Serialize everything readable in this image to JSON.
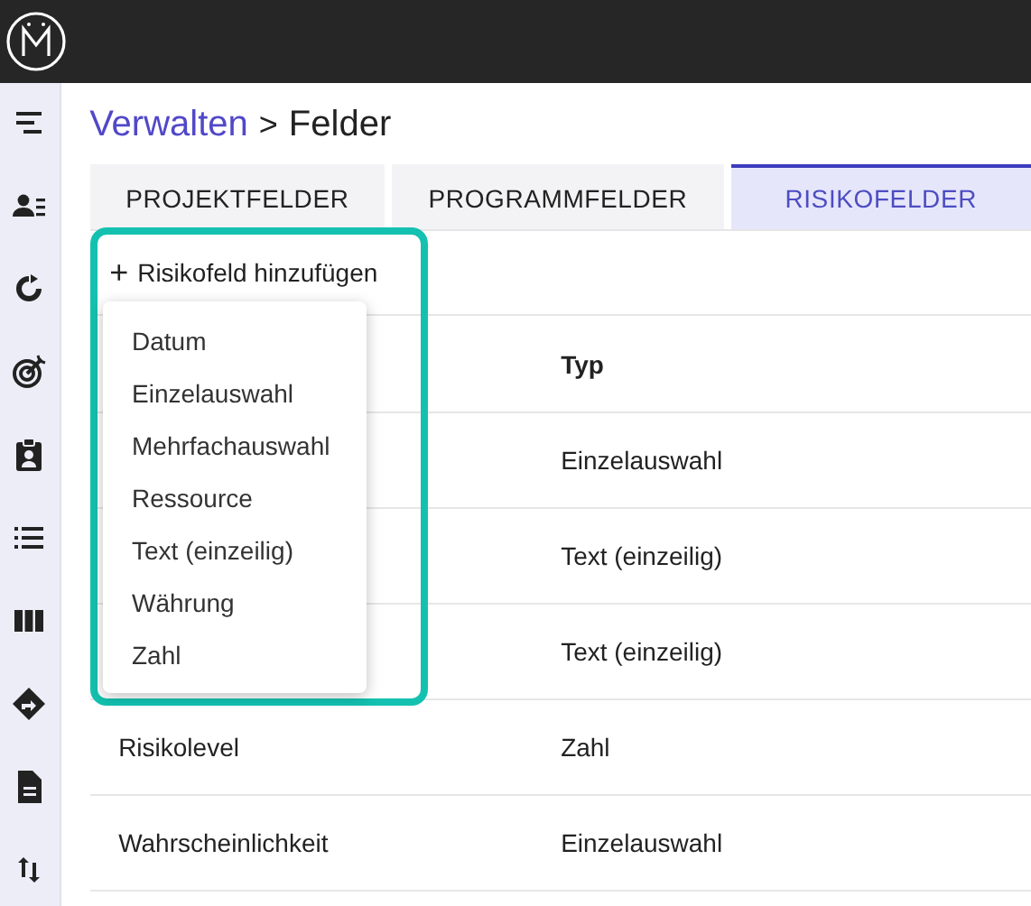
{
  "breadcrumb": {
    "parent": "Verwalten",
    "separator": ">",
    "current": "Felder"
  },
  "tabs": [
    {
      "label": "PROJEKTFELDER",
      "selected": false
    },
    {
      "label": "PROGRAMMFELDER",
      "selected": false
    },
    {
      "label": "RISIKOFELDER",
      "selected": true
    }
  ],
  "add_button": {
    "icon": "+",
    "label": "Risikofeld hinzufügen"
  },
  "add_menu": {
    "items": [
      "Datum",
      "Einzelauswahl",
      "Mehrfachauswahl",
      "Ressource",
      "Text (einzeilig)",
      "Währung",
      "Zahl"
    ]
  },
  "table": {
    "columns": [
      null,
      "Typ"
    ],
    "rows": [
      {
        "type": "Einzelauswahl"
      },
      {
        "type": "Text (einzeilig)"
      },
      {
        "type": "Text (einzeilig)"
      },
      {
        "name": "Risikolevel",
        "type": "Zahl"
      },
      {
        "name": "Wahrscheinlichkeit",
        "type": "Einzelauswahl"
      }
    ]
  }
}
